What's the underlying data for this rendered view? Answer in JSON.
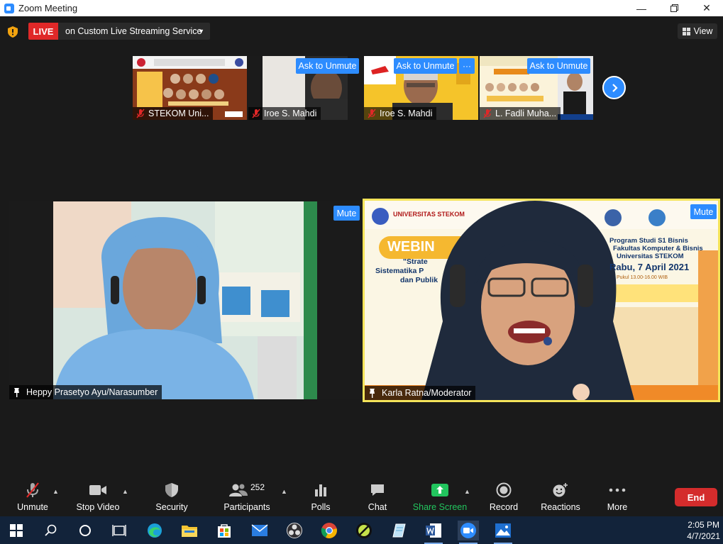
{
  "window": {
    "title": "Zoom Meeting",
    "controls": [
      "minimize",
      "restore",
      "close"
    ]
  },
  "topbar": {
    "live_badge": "LIVE",
    "live_service": "on Custom Live Streaming Service",
    "view_label": "View"
  },
  "thumbnails": [
    {
      "name": "STEKOM Uni...",
      "muted": true
    },
    {
      "name": "Iroe S. Mahdi",
      "muted": true,
      "ask_label": "Ask to Unmute"
    },
    {
      "name": "Iroe S. Mahdi",
      "muted": true,
      "ask_label": "Ask to Unmute",
      "more": "···"
    },
    {
      "name": "L. Fadli Muha...",
      "muted": true,
      "ask_label": "Ask to Unmute"
    }
  ],
  "videos": [
    {
      "name": "Heppy Prasetyo Ayu/Narasumber",
      "mute_label": "Mute"
    },
    {
      "name": "Karla Ratna/Moderator",
      "mute_label": "Mute",
      "active_speaker": true
    }
  ],
  "poster_text": {
    "university": "UNIVERSITAS STEKOM",
    "webinar": "WEBIN",
    "strate": "\"Strate",
    "sistematika": "Sistematika P",
    "publika": "dan Publik",
    "program1": "Program Studi S1 Bisnis",
    "program2": "Fakultas Komputer & Bisnis",
    "program3": "Universitas STEKOM",
    "date": "Rabu, 7 April 2021",
    "time": "Pukul 13.00-16.00 WIB"
  },
  "toolbar": {
    "unmute": "Unmute",
    "stop_video": "Stop Video",
    "security": "Security",
    "participants": "Participants",
    "participants_count": "252",
    "polls": "Polls",
    "chat": "Chat",
    "share_screen": "Share Screen",
    "record": "Record",
    "reactions": "Reactions",
    "more": "More",
    "end": "End"
  },
  "taskbar": {
    "time": "2:05 PM",
    "date": "4/7/2021",
    "apps": [
      "start-icon",
      "search-icon",
      "cortana-icon",
      "task-view-icon",
      "edge-icon",
      "file-explorer-icon",
      "store-icon",
      "mail-icon",
      "obs-icon",
      "chrome-icon",
      "pen-app-icon",
      "notepad-icon",
      "word-icon",
      "zoom-icon",
      "photos-icon"
    ]
  },
  "colors": {
    "zoom_blue": "#2d8cff",
    "live_red": "#e02828",
    "end_red": "#d42c2c",
    "share_green": "#22c55e",
    "active_speaker_border": "#f5e45a",
    "background": "#1a1a1a"
  }
}
